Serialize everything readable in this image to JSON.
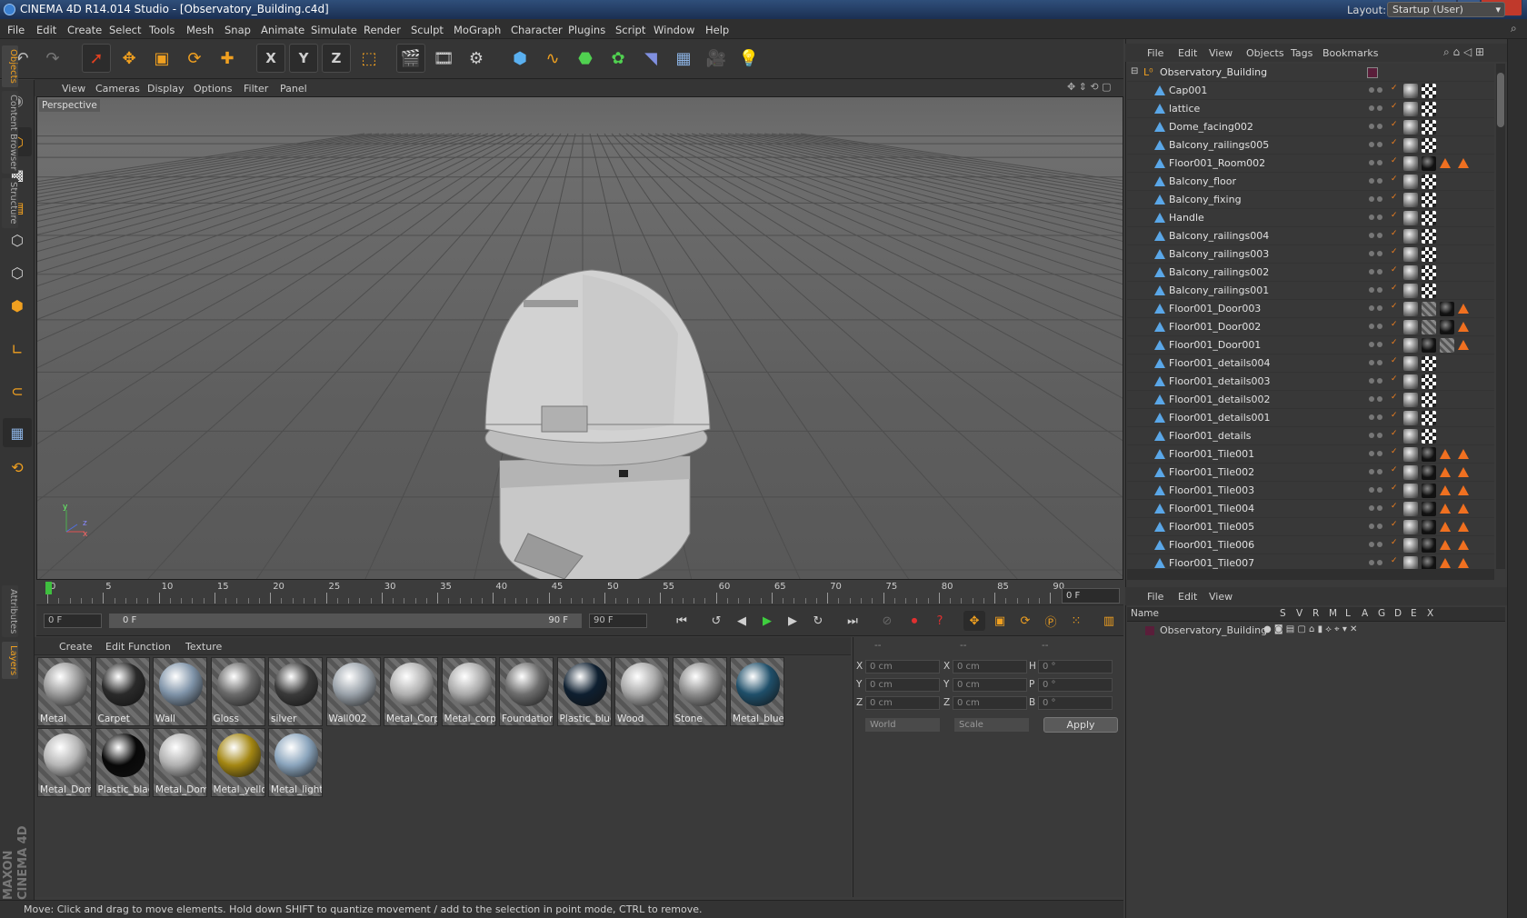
{
  "window": {
    "title": "CINEMA 4D R14.014 Studio - [Observatory_Building.c4d]",
    "controls": [
      "–",
      "❐",
      "✕"
    ]
  },
  "menubar": {
    "items": [
      "File",
      "Edit",
      "Create",
      "Select",
      "Tools",
      "Mesh",
      "Snap",
      "Animate",
      "Simulate",
      "Render",
      "Sculpt",
      "MoGraph",
      "Character",
      "Plugins",
      "Script",
      "Window",
      "Help"
    ],
    "layout_label": "Layout:",
    "layout_value": "Startup (User)"
  },
  "toolbar": {
    "axis_x": "X",
    "axis_y": "Y",
    "axis_z": "Z"
  },
  "viewport": {
    "menu": [
      "View",
      "Cameras",
      "Display",
      "Options",
      "Filter",
      "Panel"
    ],
    "label": "Perspective",
    "axis_labels": {
      "y": "y",
      "z": "z",
      "x": "x"
    }
  },
  "timeline": {
    "ticks": [
      "0",
      "5",
      "10",
      "15",
      "20",
      "25",
      "30",
      "35",
      "40",
      "45",
      "50",
      "55",
      "60",
      "65",
      "70",
      "75",
      "80",
      "85",
      "90"
    ],
    "current_frame": "0 F"
  },
  "transport": {
    "start_field": "0 F",
    "range_start": "0 F",
    "range_end": "90 F",
    "end_field": "90 F"
  },
  "materials": {
    "menu": [
      "Create",
      "Edit",
      "Function",
      "Texture"
    ],
    "items": [
      {
        "name": "Metal",
        "color": "#9a9a9a"
      },
      {
        "name": "Carpet",
        "color": "#2a2a2a"
      },
      {
        "name": "Wall",
        "color": "#7f93a8"
      },
      {
        "name": "Gloss",
        "color": "#6a6a6a"
      },
      {
        "name": "silver",
        "color": "#3a3a3a"
      },
      {
        "name": "Wall002",
        "color": "#9aa2aa"
      },
      {
        "name": "Metal_Corp",
        "color": "#b0b0b0"
      },
      {
        "name": "Metal_corp",
        "color": "#aaaaaa"
      },
      {
        "name": "Foundation",
        "color": "#6e6e6e"
      },
      {
        "name": "Plastic_blue",
        "color": "#0e1f30"
      },
      {
        "name": "Wood",
        "color": "#a8a8a8"
      },
      {
        "name": "Stone",
        "color": "#8c8c8c"
      },
      {
        "name": "Metal_blue",
        "color": "#1f4f6a"
      },
      {
        "name": "Metal_Dom",
        "color": "#b5b5b5"
      },
      {
        "name": "Plastic_black",
        "color": "#080808"
      },
      {
        "name": "Metal_Dom",
        "color": "#b0b0b0"
      },
      {
        "name": "Metal_yellow",
        "color": "#a38612"
      },
      {
        "name": "Metal_light",
        "color": "#8aa4bc"
      }
    ]
  },
  "coords": {
    "headers": [
      "--",
      "--",
      "--"
    ],
    "rows": [
      {
        "l1": "X",
        "v1": "0 cm",
        "l2": "X",
        "v2": "0 cm",
        "l3": "H",
        "v3": "0 °"
      },
      {
        "l1": "Y",
        "v1": "0 cm",
        "l2": "Y",
        "v2": "0 cm",
        "l3": "P",
        "v3": "0 °"
      },
      {
        "l1": "Z",
        "v1": "0 cm",
        "l2": "Z",
        "v2": "0 cm",
        "l3": "B",
        "v3": "0 °"
      }
    ],
    "mode1": "World",
    "mode2": "Scale",
    "apply": "Apply"
  },
  "status": {
    "text": "Move: Click and drag to move elements. Hold down SHIFT to quantize movement / add to the selection in point mode, CTRL to remove."
  },
  "objects": {
    "menu": [
      "File",
      "Edit",
      "View",
      "Objects",
      "Tags",
      "Bookmarks"
    ],
    "root": "Observatory_Building",
    "rows": [
      {
        "name": "Cap001",
        "tags": [
          "sph",
          "chk"
        ]
      },
      {
        "name": "lattice",
        "tags": [
          "sph",
          "chk"
        ]
      },
      {
        "name": "Dome_facing002",
        "tags": [
          "sph",
          "chk"
        ]
      },
      {
        "name": "Balcony_railings005",
        "tags": [
          "sph",
          "chk"
        ]
      },
      {
        "name": "Floor001_Room002",
        "tags": [
          "sph",
          "blk",
          "tri",
          "tri"
        ]
      },
      {
        "name": "Balcony_floor",
        "tags": [
          "sph",
          "chk"
        ]
      },
      {
        "name": "Balcony_fixing",
        "tags": [
          "sph",
          "chk"
        ]
      },
      {
        "name": "Handle",
        "tags": [
          "sph",
          "chk"
        ]
      },
      {
        "name": "Balcony_railings004",
        "tags": [
          "sph",
          "chk"
        ]
      },
      {
        "name": "Balcony_railings003",
        "tags": [
          "sph",
          "chk"
        ]
      },
      {
        "name": "Balcony_railings002",
        "tags": [
          "sph",
          "chk"
        ]
      },
      {
        "name": "Balcony_railings001",
        "tags": [
          "sph",
          "chk"
        ]
      },
      {
        "name": "Floor001_Door003",
        "tags": [
          "sph",
          "hatch",
          "blk",
          "tri"
        ]
      },
      {
        "name": "Floor001_Door002",
        "tags": [
          "sph",
          "hatch",
          "blk",
          "tri"
        ]
      },
      {
        "name": "Floor001_Door001",
        "tags": [
          "sph",
          "blk",
          "hatch",
          "tri"
        ]
      },
      {
        "name": "Floor001_details004",
        "tags": [
          "sph",
          "chk"
        ]
      },
      {
        "name": "Floor001_details003",
        "tags": [
          "sph",
          "chk"
        ]
      },
      {
        "name": "Floor001_details002",
        "tags": [
          "sph",
          "chk"
        ]
      },
      {
        "name": "Floor001_details001",
        "tags": [
          "sph",
          "chk"
        ]
      },
      {
        "name": "Floor001_details",
        "tags": [
          "sph",
          "chk"
        ]
      },
      {
        "name": "Floor001_Tile001",
        "tags": [
          "sph",
          "blk",
          "tri",
          "tri"
        ]
      },
      {
        "name": "Floor001_Tile002",
        "tags": [
          "sph",
          "blk",
          "tri",
          "tri"
        ]
      },
      {
        "name": "Floor001_Tile003",
        "tags": [
          "sph",
          "blk",
          "tri",
          "tri"
        ]
      },
      {
        "name": "Floor001_Tile004",
        "tags": [
          "sph",
          "blk",
          "tri",
          "tri"
        ]
      },
      {
        "name": "Floor001_Tile005",
        "tags": [
          "sph",
          "blk",
          "tri",
          "tri"
        ]
      },
      {
        "name": "Floor001_Tile006",
        "tags": [
          "sph",
          "blk",
          "tri",
          "tri"
        ]
      },
      {
        "name": "Floor001_Tile007",
        "tags": [
          "sph",
          "blk",
          "tri",
          "tri"
        ]
      }
    ]
  },
  "layers": {
    "menu": [
      "File",
      "Edit",
      "View"
    ],
    "columns": [
      "Name",
      "S",
      "V",
      "R",
      "M",
      "L",
      "A",
      "G",
      "D",
      "E",
      "X"
    ],
    "row": "Observatory_Building"
  },
  "side_tabs": [
    "Objects",
    "Content Browser",
    "Structure",
    "Attributes",
    "Layers"
  ],
  "brand": "MAXON CINEMA 4D"
}
